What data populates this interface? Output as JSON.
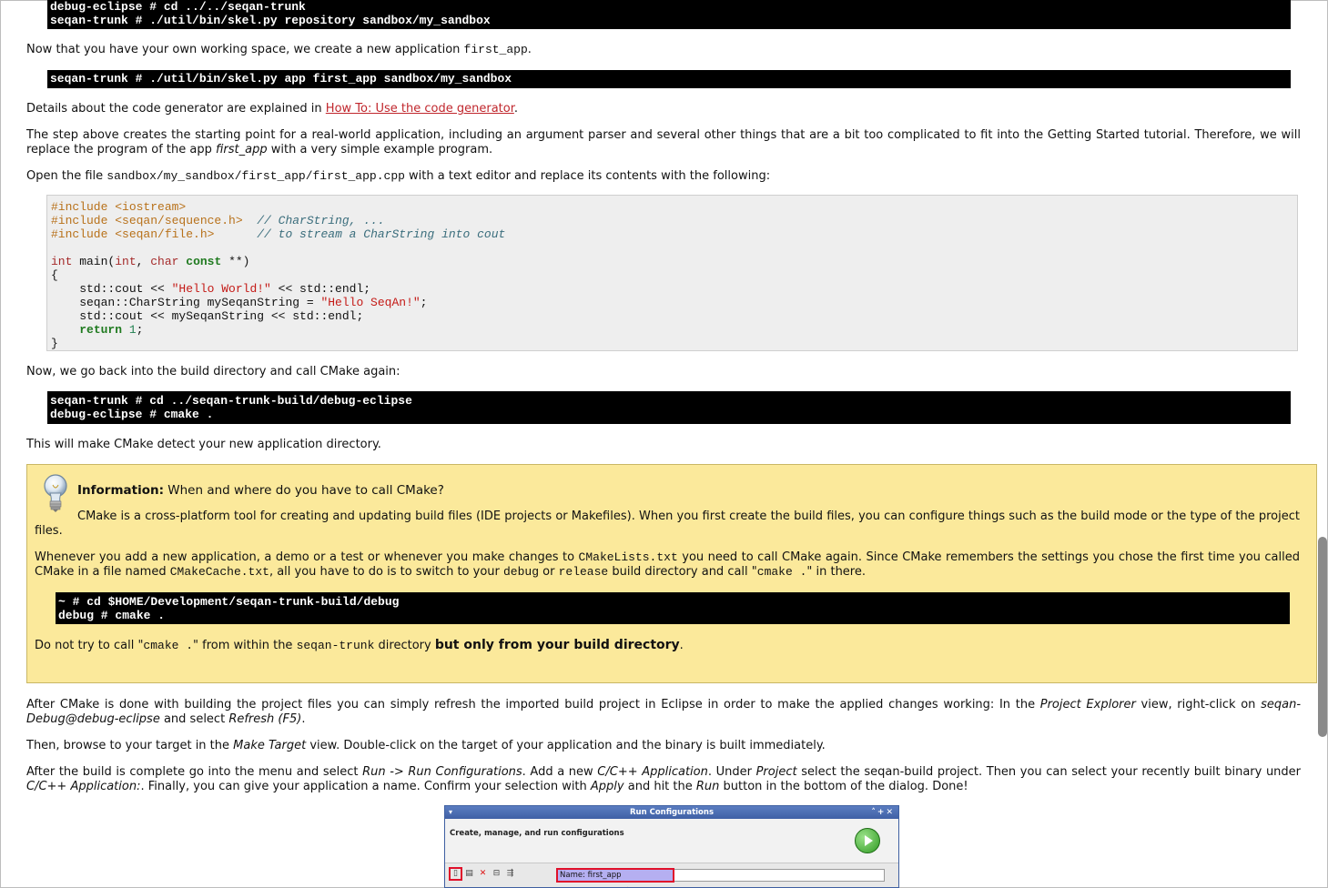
{
  "top_terminal": {
    "line1": "debug-eclipse # cd ../../seqan-trunk",
    "line2": "seqan-trunk # ./util/bin/skel.py repository sandbox/my_sandbox"
  },
  "p1": {
    "before": "Now that you have your own working space, we create a new application ",
    "code": "first_app",
    "after": "."
  },
  "term2": {
    "line1": "seqan-trunk # ./util/bin/skel.py app first_app sandbox/my_sandbox"
  },
  "p2": {
    "before": "Details about the code generator are explained in ",
    "link": "How To: Use the code generator",
    "after": "."
  },
  "p3": {
    "before": "The step above creates the starting point for a real-world application, including an argument parser and several other things that are a bit too complicated to fit into the Getting Started tutorial. Therefore, we will replace the program of the app ",
    "em": "first_app",
    "after": " with a very simple example program."
  },
  "p4": {
    "before": "Open the file ",
    "code": "sandbox/my_sandbox/first_app/first_app.cpp",
    "after": " with a text editor and replace its contents with the following:"
  },
  "code": {
    "inc1": "#include <iostream>",
    "inc2": "#include <seqan/sequence.h>",
    "cmt2": "// CharString, ...",
    "inc3": "#include <seqan/file.h>",
    "cmt3": "// to stream a CharString into cout",
    "kw_int": "int",
    "main_sig": " main(",
    "kw_int2": "int",
    "comma": ", ",
    "kw_char": "char",
    "kw_const": "const",
    "sig_end": " **)",
    "open_brace": "{",
    "l1a": "    std::cout << ",
    "l1s": "\"Hello World!\"",
    "l1b": " << std::endl;",
    "l2a": "    seqan::CharString mySeqanString = ",
    "l2s": "\"Hello SeqAn!\"",
    "l2b": ";",
    "l3": "    std::cout << mySeqanString << std::endl;",
    "kw_return": "return",
    "ret_num": "1",
    "ret_end": ";",
    "close_brace": "}"
  },
  "p5": "Now, we go back into the build directory and call CMake again:",
  "term3": {
    "line1": "seqan-trunk # cd ../seqan-trunk-build/debug-eclipse",
    "line2": "debug-eclipse # cmake ."
  },
  "p6": "This will make CMake detect your new application directory.",
  "info": {
    "title_bold": "Information:",
    "title_rest": " When and where do you have to call CMake?",
    "p1": "CMake is a cross-platform tool for creating and updating build files (IDE projects or Makefiles). When you first create the build files, you can configure things such as the build mode or the type of the project files.",
    "p2_a": "Whenever you add a new application, a demo or a test or whenever you make changes to ",
    "p2_code1": "CMakeLists.txt",
    "p2_b": " you need to call CMake again. Since CMake remembers the settings you chose the first time you called CMake in a file named ",
    "p2_code2": "CMakeCache.txt",
    "p2_c": ", all you have to do is to switch to your ",
    "p2_code3": "debug",
    "p2_d": " or ",
    "p2_code4": "release",
    "p2_e": " build directory and call \"",
    "p2_code5": "cmake .",
    "p2_f": "\" in there.",
    "term_line1": "~ # cd $HOME/Development/seqan-trunk-build/debug",
    "term_line2": "debug # cmake .",
    "p3_a": "Do not try to call \"",
    "p3_code1": "cmake .",
    "p3_b": "\" from within the ",
    "p3_code2": "seqan-trunk",
    "p3_c": " directory ",
    "p3_bold": "but only from your build directory",
    "p3_d": "."
  },
  "p7": {
    "a": "After CMake is done with building the project files you can simply refresh the imported build project in Eclipse in order to make the applied changes working: In the ",
    "em1": "Project Explorer",
    "b": " view, right-click on ",
    "em2": "seqan-Debug@debug-eclipse",
    "c": " and select ",
    "em3": "Refresh (F5)",
    "d": "."
  },
  "p8": {
    "a": "Then, browse to your target in the ",
    "em": "Make Target",
    "b": " view. Double-click on the target of your application and the binary is built immediately."
  },
  "p9": {
    "a": "After the build is complete go into the menu and select ",
    "em1": "Run -> Run Configurations",
    "b": ". Add a new ",
    "em2": "C/C++ Application",
    "c": ". Under ",
    "em3": "Project",
    "d": " select the seqan-build project. Then you can select your recently built binary under ",
    "em4": "C/C++ Application:",
    "e": ". Finally, you can give your application a name. Confirm your selection with ",
    "em5": "Apply",
    "f": " and hit the ",
    "em6": "Run",
    "g": " button in the bottom of the dialog. Done!"
  },
  "dialog": {
    "title": "Run Configurations",
    "subtitle": "Create, manage, and run configurations",
    "name_label": "Name:",
    "name_value": "first_app"
  }
}
